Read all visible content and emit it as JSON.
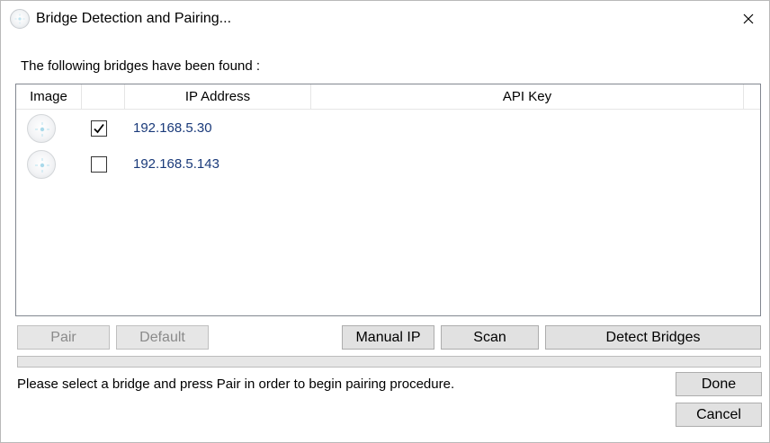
{
  "window": {
    "title": "Bridge Detection and Pairing...",
    "icon": "bridge-icon"
  },
  "found_label": "The following bridges have been found :",
  "list": {
    "columns": [
      "Image",
      "",
      "IP Address",
      "API Key"
    ],
    "rows": [
      {
        "image": "bridge-icon",
        "checked": true,
        "ip": "192.168.5.30",
        "api_key": ""
      },
      {
        "image": "bridge-icon",
        "checked": false,
        "ip": "192.168.5.143",
        "api_key": ""
      }
    ]
  },
  "buttons": {
    "pair": "Pair",
    "default": "Default",
    "manual_ip": "Manual IP",
    "scan": "Scan",
    "detect_bridges": "Detect Bridges",
    "done": "Done",
    "cancel": "Cancel"
  },
  "progress": {
    "value": 0
  },
  "status_text": "Please select a bridge and press Pair in order to begin pairing procedure."
}
